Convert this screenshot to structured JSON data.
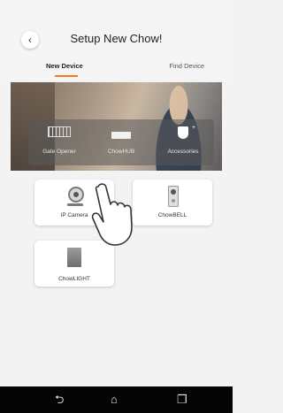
{
  "header": {
    "title": "Setup New Chow!",
    "back_icon": "chevron-left-icon"
  },
  "tabs": [
    {
      "label": "New Device",
      "active": true
    },
    {
      "label": "Find Device",
      "active": false
    }
  ],
  "accent_color": "#f47a20",
  "hero": {
    "items": [
      {
        "label": "Gate Opener",
        "icon": "gate-icon"
      },
      {
        "label": "ChowHUB",
        "icon": "hub-icon"
      },
      {
        "label": "Accessories",
        "icon": "shield-icon"
      }
    ]
  },
  "devices": [
    {
      "label": "IP Camera",
      "icon": "camera-icon"
    },
    {
      "label": "ChowBELL",
      "icon": "doorbell-icon"
    },
    {
      "label": "ChowLIGHT",
      "icon": "light-icon"
    }
  ],
  "navbar": {
    "back": "⮌",
    "home": "⌂",
    "recent": "❐"
  }
}
